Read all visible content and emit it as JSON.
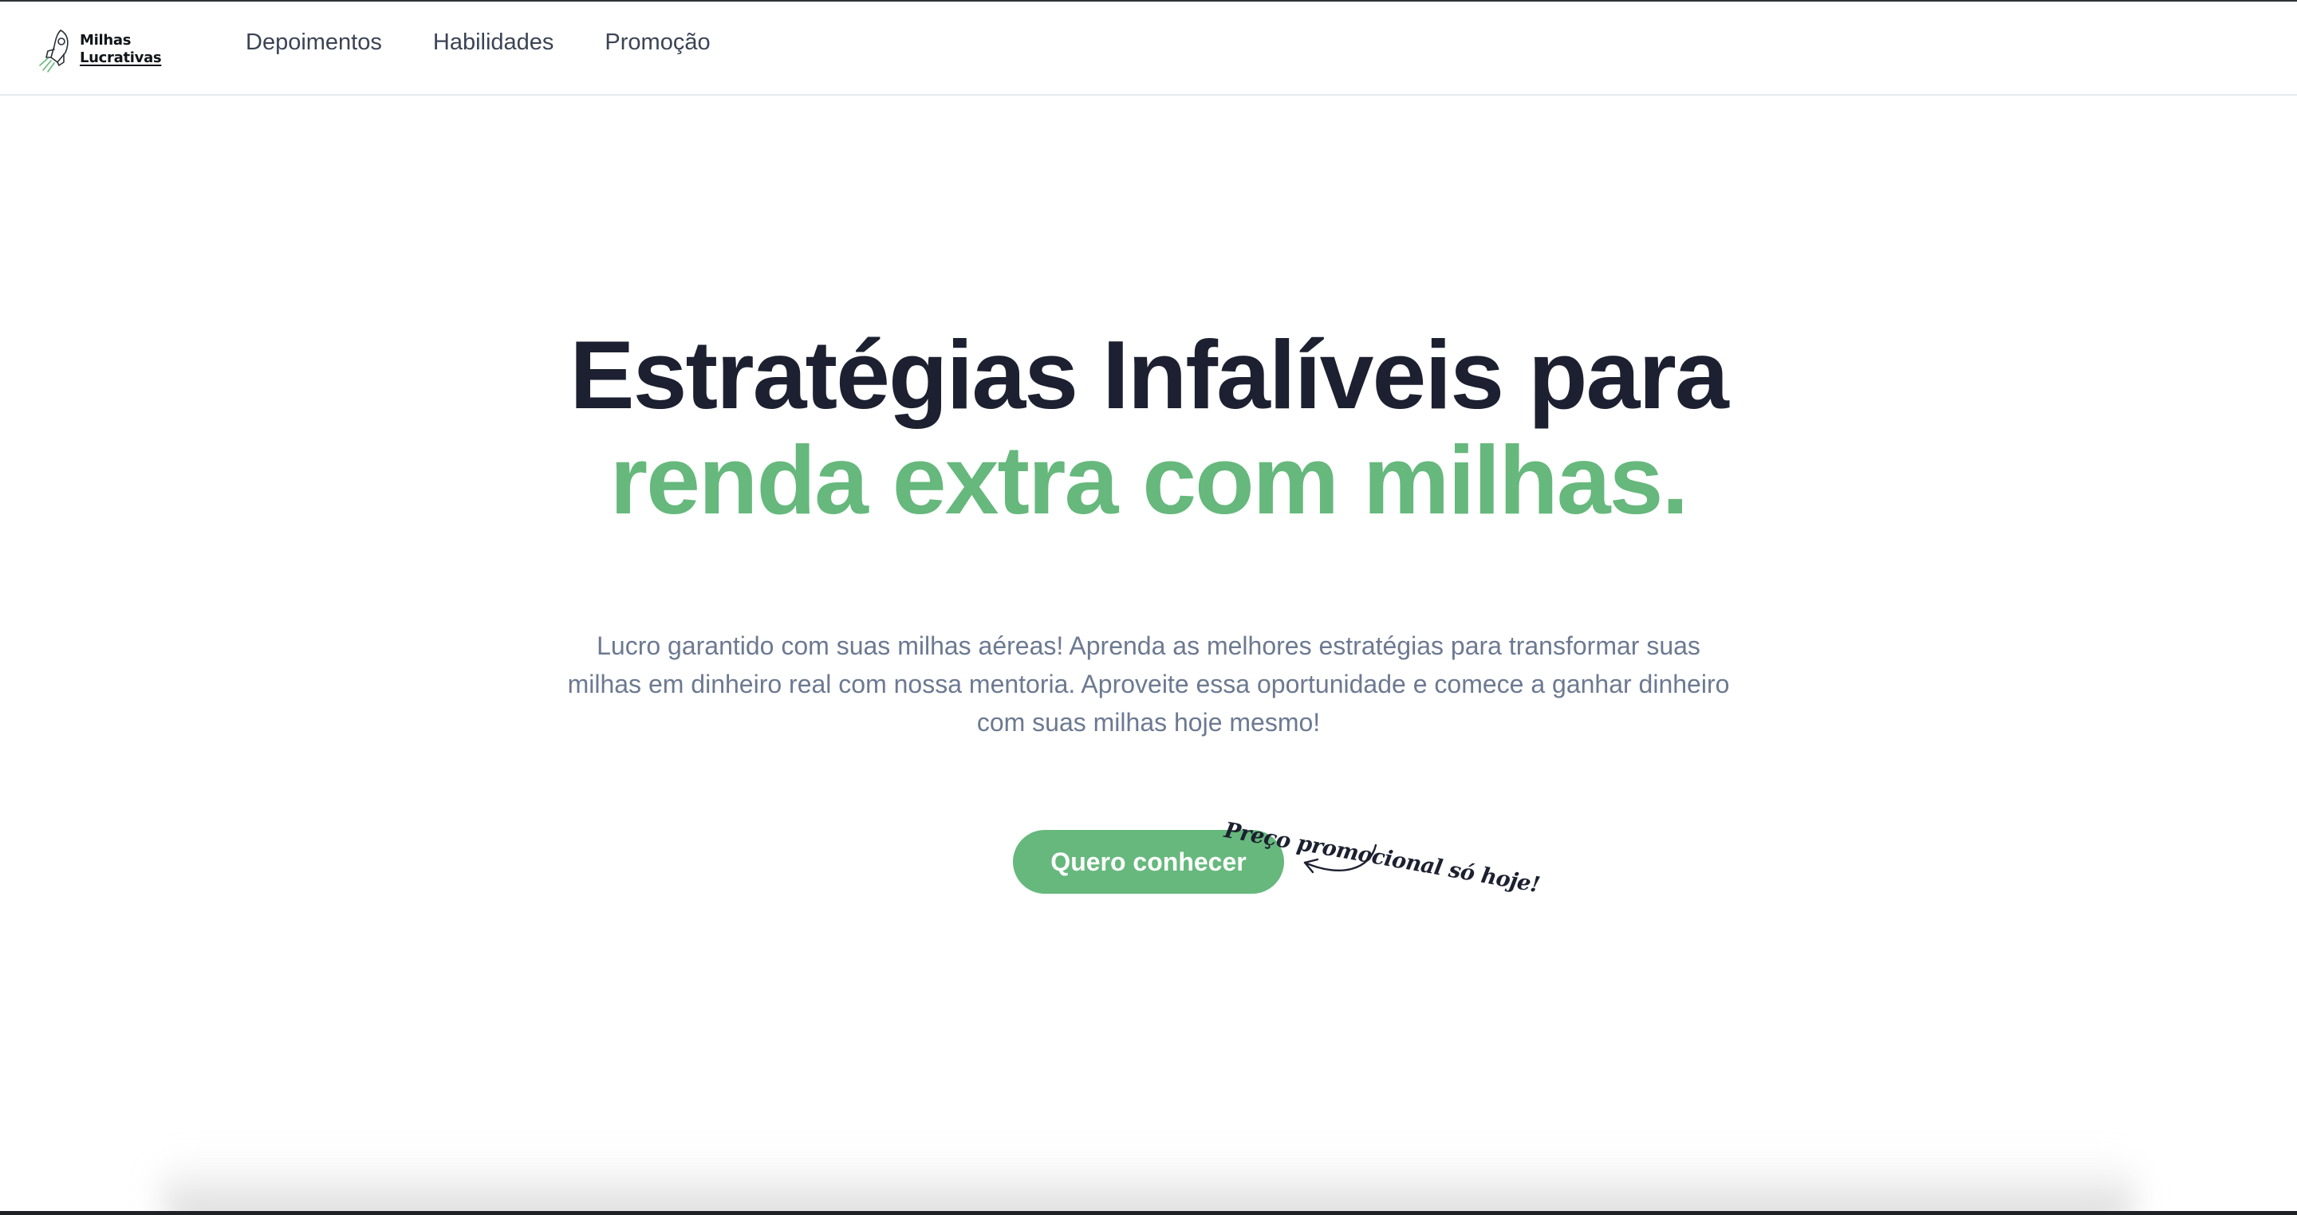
{
  "brand": {
    "line1": "Milhas",
    "line2": "Lucrativas",
    "icon": "rocket-icon",
    "accent_color": "#66b87c"
  },
  "nav": {
    "items": [
      {
        "label": "Depoimentos"
      },
      {
        "label": "Habilidades"
      },
      {
        "label": "Promoção"
      }
    ]
  },
  "hero": {
    "title_line1": "Estratégias Infalíveis para",
    "title_line2": "renda extra com milhas.",
    "description": "Lucro garantido com suas milhas aéreas! Aprenda as melhores estratégias para transformar suas milhas em dinheiro real com nossa mentoria. Aproveite essa oportunidade e comece a ganhar dinheiro com suas milhas hoje mesmo!",
    "cta_label": "Quero conhecer",
    "promo_note": "Preço promocional só hoje!",
    "arrow_icon": "curved-arrow-icon"
  }
}
